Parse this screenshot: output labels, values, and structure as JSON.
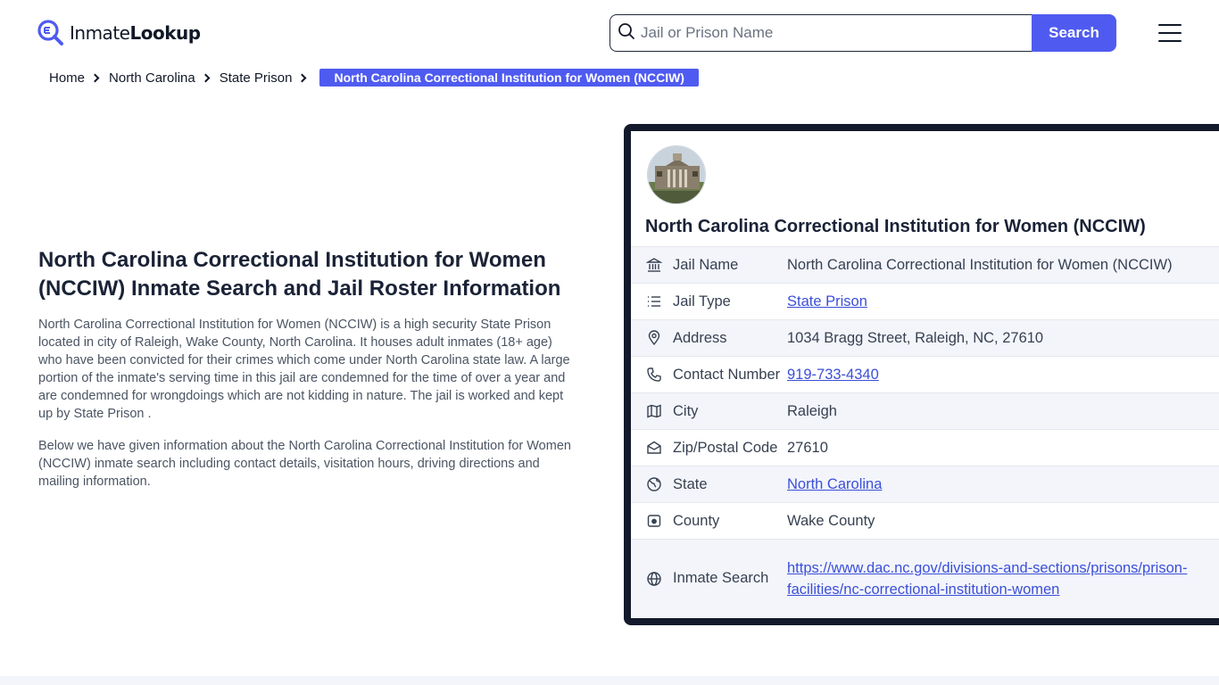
{
  "brand": {
    "name_regular": "Inmate",
    "name_bold": "Lookup"
  },
  "search": {
    "placeholder": "Jail or Prison Name",
    "button_label": "Search"
  },
  "breadcrumb": {
    "items": [
      "Home",
      "North Carolina",
      "State Prison"
    ],
    "active": "North Carolina Correctional Institution for Women (NCCIW)"
  },
  "main": {
    "title": "North Carolina Correctional Institution for Women (NCCIW) Inmate Search and Jail Roster Information",
    "paragraph1": "North Carolina Correctional Institution for Women (NCCIW) is a high security State Prison located in city of Raleigh, Wake County, North Carolina. It houses adult inmates (18+ age) who have been convicted for their crimes which come under North Carolina state law. A large portion of the inmate's serving time in this jail are condemned for the time of over a year and are condemned for wrongdoings which are not kidding in nature. The jail is worked and kept up by State Prison .",
    "paragraph2": "Below we have given information about the North Carolina Correctional Institution for Women (NCCIW) inmate search including contact details, visitation hours, driving directions and mailing information."
  },
  "card": {
    "title": "North Carolina Correctional Institution for Women (NCCIW)",
    "rows": [
      {
        "icon": "bank-icon",
        "label": "Jail Name",
        "value": "North Carolina Correctional Institution for Women (NCCIW)",
        "link": false
      },
      {
        "icon": "list-icon",
        "label": "Jail Type",
        "value": "State Prison",
        "link": true
      },
      {
        "icon": "map-pin-icon",
        "label": "Address",
        "value": "1034 Bragg Street, Raleigh, NC, 27610",
        "link": false
      },
      {
        "icon": "phone-icon",
        "label": "Contact Number",
        "value": "919-733-4340",
        "link": true
      },
      {
        "icon": "map-icon",
        "label": "City",
        "value": "Raleigh",
        "link": false
      },
      {
        "icon": "mail-open-icon",
        "label": "Zip/Postal Code",
        "value": "27610",
        "link": false
      },
      {
        "icon": "state-globe-icon",
        "label": "State",
        "value": "North Carolina",
        "link": true
      },
      {
        "icon": "county-map-icon",
        "label": "County",
        "value": "Wake County",
        "link": false
      },
      {
        "icon": "globe-icon",
        "label": "Inmate Search",
        "value": "https://www.dac.nc.gov/divisions-and-sections/prisons/prison-facilities/nc-correctional-institution-women",
        "link": true
      }
    ]
  },
  "colors": {
    "accent": "#4f5bf0",
    "card_border": "#131a2b",
    "link": "#3b4fd8",
    "row_alt": "#f3f5fb"
  }
}
